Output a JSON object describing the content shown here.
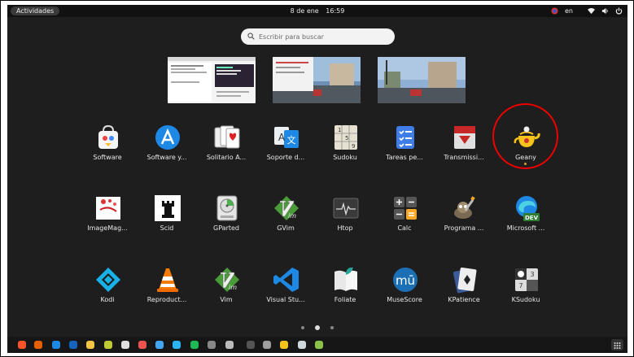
{
  "topbar": {
    "activities_label": "Actividades",
    "date": "8 de ene",
    "time": "16:59",
    "language": "en"
  },
  "search": {
    "placeholder": "Escribir para buscar"
  },
  "apps": [
    {
      "label": "Software",
      "icon": "software-store-icon"
    },
    {
      "label": "Software y...",
      "icon": "app-store-icon"
    },
    {
      "label": "Solitario A...",
      "icon": "solitaire-cards-icon"
    },
    {
      "label": "Soporte d...",
      "icon": "language-support-icon"
    },
    {
      "label": "Sudoku",
      "icon": "sudoku-grid-icon"
    },
    {
      "label": "Tareas pe...",
      "icon": "tasks-checklist-icon"
    },
    {
      "label": "Transmissi...",
      "icon": "transmission-icon"
    },
    {
      "label": "Geany",
      "icon": "geany-teapot-icon"
    },
    {
      "label": "ImageMag...",
      "icon": "imagemagick-icon"
    },
    {
      "label": "Scid",
      "icon": "chess-rook-icon"
    },
    {
      "label": "GParted",
      "icon": "gparted-disk-icon"
    },
    {
      "label": "GVim",
      "icon": "gvim-icon"
    },
    {
      "label": "Htop",
      "icon": "htop-monitor-icon"
    },
    {
      "label": "Calc",
      "icon": "calculator-icon"
    },
    {
      "label": "Programa ...",
      "icon": "gimp-icon"
    },
    {
      "label": "Microsoft ...",
      "icon": "edge-dev-icon"
    },
    {
      "label": "Kodi",
      "icon": "kodi-icon"
    },
    {
      "label": "Reproduct...",
      "icon": "vlc-cone-icon"
    },
    {
      "label": "Vim",
      "icon": "vim-icon"
    },
    {
      "label": "Visual Stu...",
      "icon": "vscode-icon"
    },
    {
      "label": "Foliate",
      "icon": "foliate-book-icon"
    },
    {
      "label": "MuseScore",
      "icon": "musescore-icon"
    },
    {
      "label": "KPatience",
      "icon": "kpatience-card-icon"
    },
    {
      "label": "KSudoku",
      "icon": "ksudoku-icon"
    }
  ],
  "dock": [
    "brave-icon",
    "firefox-icon",
    "edge-icon",
    "browser-icon",
    "files-icon",
    "app-icon",
    "doc-icon",
    "store-icon",
    "globe-icon",
    "telegram-icon",
    "spotify-icon",
    "terminal-icon",
    "tool-icon",
    "screen-icon",
    "monitor-icon",
    "teapot-icon",
    "image-icon",
    "archive-icon"
  ],
  "colors": {
    "background": "#1e1e1e",
    "annotation": "#e00000",
    "search_bg": "#f3f3f3"
  }
}
